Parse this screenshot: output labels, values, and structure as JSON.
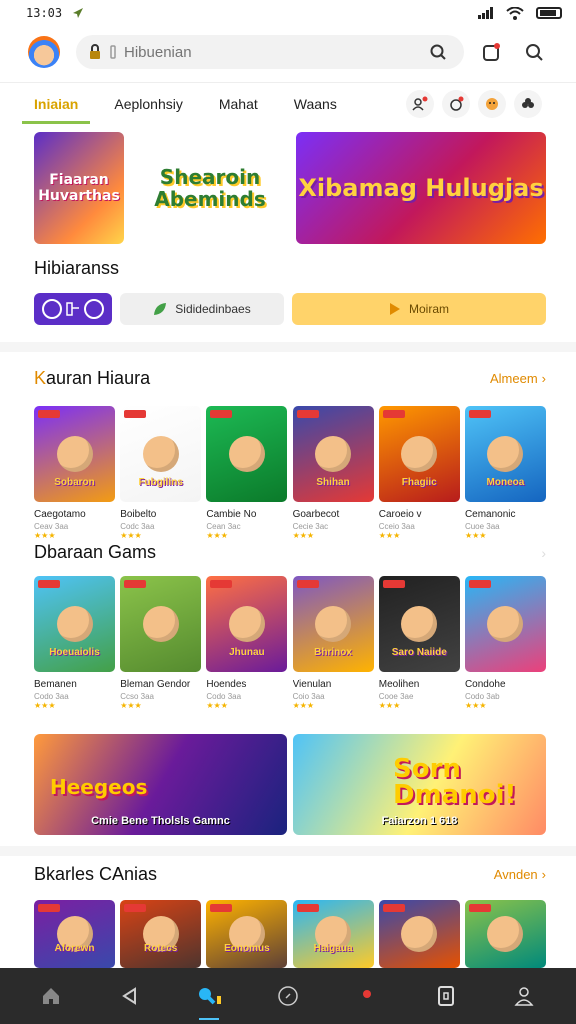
{
  "status": {
    "time": "13:03"
  },
  "search": {
    "placeholder": "Hibuenian"
  },
  "tabs": [
    {
      "label": "Iniaian",
      "active": true
    },
    {
      "label": "Aeplonhsiy"
    },
    {
      "label": "Mahat"
    },
    {
      "label": "Waans"
    }
  ],
  "banners": [
    {
      "title": "Fiaaran Huvarthas"
    },
    {
      "title": "Shearoin Abeminds"
    },
    {
      "title": "Xibamag Hulugjas"
    }
  ],
  "featured": {
    "heading": "Hibiaranss",
    "secondary_label": "Sididedinbaes",
    "play_label": "Moiram"
  },
  "section1": {
    "title_accent": "K",
    "title_rest": "auran Hiaura",
    "view_all": "Almeem",
    "games": [
      {
        "name": "Caegotamo",
        "sub": "Ceav 3aa",
        "stars": "★★★",
        "thumb_text": "Sobaron",
        "colors": [
          "#7b2ff7",
          "#f39c12"
        ]
      },
      {
        "name": "Boibelto",
        "sub": "Codc 3aa",
        "stars": "★★★",
        "thumb_text": "Fubgilins",
        "colors": [
          "#ffffff",
          "#f4f4f4"
        ]
      },
      {
        "name": "Cambie No",
        "sub": "Cean 3ac",
        "stars": "★★★",
        "thumb_text": "",
        "colors": [
          "#1db954",
          "#0b7a2a"
        ]
      },
      {
        "name": "Goarbecot",
        "sub": "Cecie 3ac",
        "stars": "★★★",
        "thumb_text": "Shihan",
        "colors": [
          "#3949ab",
          "#e53935"
        ]
      },
      {
        "name": "Caroeio v",
        "sub": "Cceio 3aa",
        "stars": "★★★",
        "thumb_text": "Fhagiic",
        "colors": [
          "#ff9800",
          "#b71c1c"
        ]
      },
      {
        "name": "Cemanonic",
        "sub": "Cuoe 3aa",
        "stars": "★★★",
        "thumb_text": "Moneoa",
        "colors": [
          "#4fc3f7",
          "#1565c0"
        ]
      }
    ]
  },
  "section2": {
    "title": "Dbaraan Gams",
    "games": [
      {
        "name": "Bemanen",
        "sub": "Codo 3aa",
        "stars": "★★★",
        "thumb_text": "Hoeuaiolis",
        "colors": [
          "#4fc3f7",
          "#43a047"
        ]
      },
      {
        "name": "Bleman Gendor",
        "sub": "Ccso 3aa",
        "stars": "★★★",
        "thumb_text": "",
        "colors": [
          "#8bc34a",
          "#558b2f"
        ]
      },
      {
        "name": "Hoendes",
        "sub": "Codo 3aa",
        "stars": "★★★",
        "thumb_text": "Jhunau",
        "colors": [
          "#ff7043",
          "#6a1b9a"
        ]
      },
      {
        "name": "Vienulan",
        "sub": "Coio 3aa",
        "stars": "★★★",
        "thumb_text": "Bhrinox",
        "colors": [
          "#7e57c2",
          "#ffb300"
        ]
      },
      {
        "name": "Meolihen",
        "sub": "Cooe 3ae",
        "stars": "★★★",
        "thumb_text": "Saro Naiide",
        "colors": [
          "#212121",
          "#424242"
        ]
      },
      {
        "name": "Condohe",
        "sub": "Codo 3ab",
        "stars": "★★★",
        "thumb_text": "",
        "colors": [
          "#29b6f6",
          "#ec407a"
        ]
      }
    ]
  },
  "promos": [
    {
      "big": "Heegeos",
      "label": "Cmie Bene Tholsls  Gamnc"
    },
    {
      "big": "Sorn Dmanoi!",
      "label": "Faiarzon 1 618"
    }
  ],
  "section3": {
    "title": "Bkarles CAnias",
    "view_all": "Avnden",
    "games": [
      {
        "thumb_text": "Aforewn",
        "colors": [
          "#7b1fa2",
          "#3949ab"
        ]
      },
      {
        "thumb_text": "Rotecs",
        "colors": [
          "#d84315",
          "#4e342e"
        ]
      },
      {
        "thumb_text": "Eonomus",
        "colors": [
          "#ffb300",
          "#5d4037"
        ]
      },
      {
        "thumb_text": "Haigaua",
        "colors": [
          "#29b6f6",
          "#ffca28"
        ]
      },
      {
        "thumb_text": "",
        "colors": [
          "#3949ab",
          "#e65100"
        ]
      },
      {
        "thumb_text": "",
        "colors": [
          "#8bc34a",
          "#00897b"
        ]
      }
    ]
  },
  "bottom_nav": [
    {
      "icon": "home-icon"
    },
    {
      "icon": "back-icon"
    },
    {
      "icon": "games-icon",
      "active": true
    },
    {
      "icon": "compass-icon"
    },
    {
      "icon": "notification-icon"
    },
    {
      "icon": "tablet-icon"
    },
    {
      "icon": "profile-icon"
    }
  ],
  "colors": {
    "accent": "#e08a00",
    "tab_active": "#d9a300",
    "underline": "#8bc34a",
    "nav_bg": "#2b2b2b"
  }
}
